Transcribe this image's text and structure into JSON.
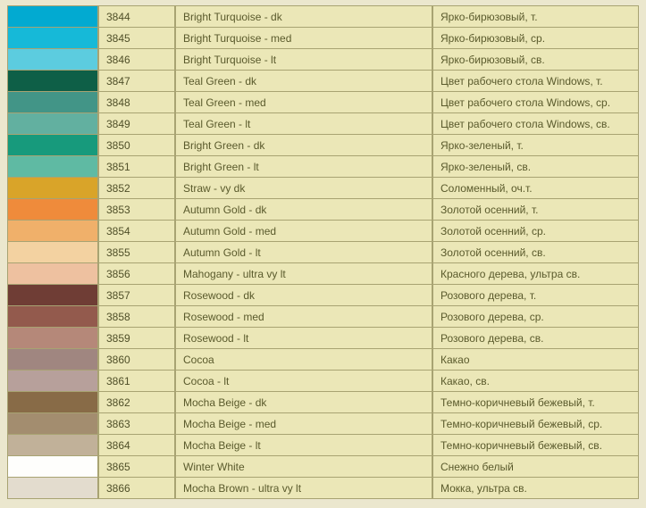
{
  "rows": [
    {
      "code": "3844",
      "swatch": "#02aad1",
      "en": "Bright Turquoise - dk",
      "ru": "Ярко-бирюзовый, т."
    },
    {
      "code": "3845",
      "swatch": "#16b9d8",
      "en": "Bright Turquoise - med",
      "ru": "Ярко-бирюзовый, ср."
    },
    {
      "code": "3846",
      "swatch": "#5cccdf",
      "en": "Bright Turquoise - lt",
      "ru": "Ярко-бирюзовый, св."
    },
    {
      "code": "3847",
      "swatch": "#0e5f47",
      "en": "Teal Green - dk",
      "ru": "Цвет рабочего стола Windows, т."
    },
    {
      "code": "3848",
      "swatch": "#429587",
      "en": "Teal Green - med",
      "ru": "Цвет рабочего стола Windows, ср."
    },
    {
      "code": "3849",
      "swatch": "#62b0a0",
      "en": "Teal Green - lt",
      "ru": "Цвет рабочего стола Windows, св."
    },
    {
      "code": "3850",
      "swatch": "#179a7c",
      "en": "Bright Green - dk",
      "ru": "Ярко-зеленый, т."
    },
    {
      "code": "3851",
      "swatch": "#5fbaa3",
      "en": "Bright Green - lt",
      "ru": "Ярко-зеленый, св."
    },
    {
      "code": "3852",
      "swatch": "#d9a429",
      "en": "Straw - vy dk",
      "ru": "Соломенный, оч.т."
    },
    {
      "code": "3853",
      "swatch": "#ef8b3b",
      "en": "Autumn Gold - dk",
      "ru": "Золотой осенний, т."
    },
    {
      "code": "3854",
      "swatch": "#f0b06a",
      "en": "Autumn Gold - med",
      "ru": "Золотой осенний, ср."
    },
    {
      "code": "3855",
      "swatch": "#f3d2a1",
      "en": "Autumn Gold - lt",
      "ru": "Золотой осенний, св."
    },
    {
      "code": "3856",
      "swatch": "#eec1a0",
      "en": "Mahogany - ultra vy lt",
      "ru": "Красного дерева, ультра св."
    },
    {
      "code": "3857",
      "swatch": "#6f3d35",
      "en": "Rosewood - dk",
      "ru": "Розового дерева, т."
    },
    {
      "code": "3858",
      "swatch": "#935a4d",
      "en": "Rosewood - med",
      "ru": "Розового дерева, ср."
    },
    {
      "code": "3859",
      "swatch": "#b58879",
      "en": "Rosewood - lt",
      "ru": "Розового дерева, св."
    },
    {
      "code": "3860",
      "swatch": "#a08680",
      "en": "Cocoa",
      "ru": "Какао"
    },
    {
      "code": "3861",
      "swatch": "#b7a09b",
      "en": "Cocoa - lt",
      "ru": "Какао, св."
    },
    {
      "code": "3862",
      "swatch": "#886b47",
      "en": "Mocha Beige - dk",
      "ru": "Темно-коричневый бежевый, т."
    },
    {
      "code": "3863",
      "swatch": "#a38d6f",
      "en": "Mocha Beige - med",
      "ru": "Темно-коричневый бежевый, ср."
    },
    {
      "code": "3864",
      "swatch": "#c1b199",
      "en": "Mocha Beige - lt",
      "ru": "Темно-коричневый бежевый, св."
    },
    {
      "code": "3865",
      "swatch": "#fefefc",
      "en": "Winter White",
      "ru": "Снежно белый"
    },
    {
      "code": "3866",
      "swatch": "#e3dcce",
      "en": "Mocha Brown - ultra vy lt",
      "ru": "Мокка, ультра св."
    }
  ]
}
